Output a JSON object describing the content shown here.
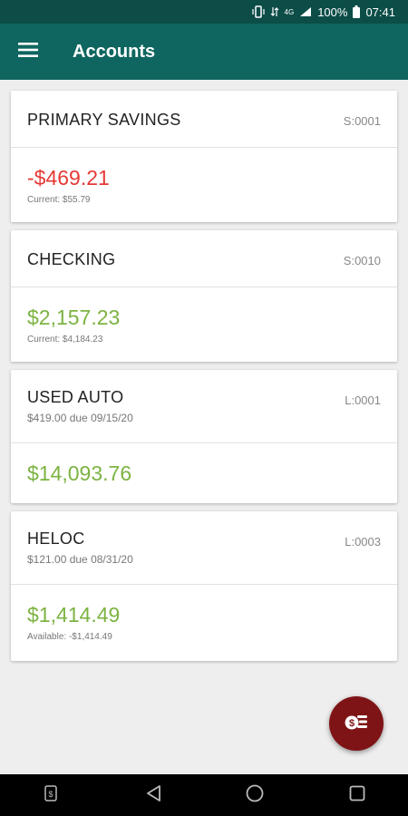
{
  "status_bar": {
    "battery": "100%",
    "time": "07:41",
    "network": "4G"
  },
  "app_bar": {
    "title": "Accounts"
  },
  "accounts": [
    {
      "name": "PRIMARY SAVINGS",
      "code": "S:0001",
      "amount": "-$469.21",
      "sub": "Current: $55.79"
    },
    {
      "name": "CHECKING",
      "code": "S:0010",
      "amount": "$2,157.23",
      "sub": "Current: $4,184.23"
    },
    {
      "name": "USED AUTO",
      "code": "L:0001",
      "due": "$419.00 due 09/15/20",
      "amount": "$14,093.76"
    },
    {
      "name": "HELOC",
      "code": "L:0003",
      "due": "$121.00 due 08/31/20",
      "amount": "$1,414.49",
      "sub": "Available: -$1,414.49"
    }
  ],
  "colors": {
    "app_bar": "#0f6660",
    "status_bar": "#0c4d48",
    "negative": "#e53935",
    "positive": "#7cb342",
    "fab": "#7f1416"
  },
  "icons": {
    "menu": "hamburger-icon",
    "fab": "payment-icon",
    "nav": [
      "notification-icon",
      "back-icon",
      "home-icon",
      "recents-icon"
    ]
  }
}
